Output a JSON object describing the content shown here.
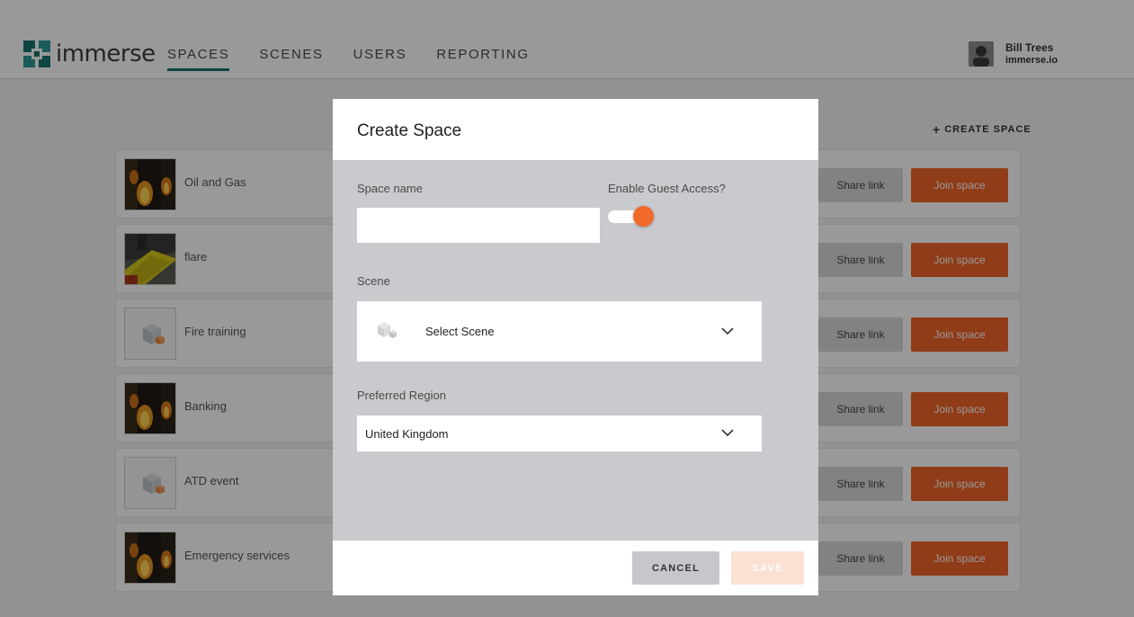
{
  "app": {
    "logo_text": "immerse",
    "brand_color": "#1a7470",
    "accent_color": "#f0652a"
  },
  "nav": {
    "items": [
      {
        "label": "SPACES",
        "active": true
      },
      {
        "label": "SCENES",
        "active": false
      },
      {
        "label": "USERS",
        "active": false
      },
      {
        "label": "REPORTING",
        "active": false
      }
    ]
  },
  "user": {
    "name": "Bill Trees",
    "org": "immerse.io"
  },
  "page": {
    "create_space_label": "CREATE SPACE"
  },
  "spaces": [
    {
      "name": "Oil and Gas",
      "thumb": "fire-scene",
      "share": "Share link",
      "join": "Join space"
    },
    {
      "name": "flare",
      "thumb": "flare-scene",
      "share": "Share link",
      "join": "Join space"
    },
    {
      "name": "Fire training",
      "thumb": "cube-placeholder",
      "share": "Share link",
      "join": "Join space"
    },
    {
      "name": "Banking",
      "thumb": "fire-scene",
      "share": "Share link",
      "join": "Join space"
    },
    {
      "name": "ATD event",
      "thumb": "cube-placeholder",
      "share": "Share link",
      "join": "Join space"
    },
    {
      "name": "Emergency services",
      "thumb": "fire-scene",
      "share": "Share link",
      "join": "Join space"
    }
  ],
  "modal": {
    "title": "Create Space",
    "space_name_label": "Space name",
    "space_name_value": "",
    "guest_access_label": "Enable Guest Access?",
    "guest_access_on": true,
    "scene_label": "Scene",
    "scene_value": "Select Scene",
    "region_label": "Preferred Region",
    "region_value": "United Kingdom",
    "cancel_label": "CANCEL",
    "save_label": "SAVE"
  }
}
